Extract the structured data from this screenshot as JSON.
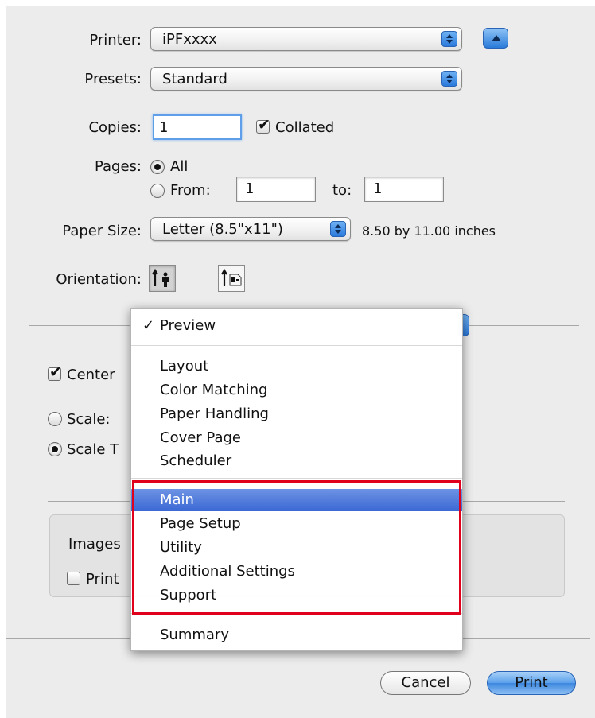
{
  "printer": {
    "label": "Printer:",
    "value": "iPFxxxx"
  },
  "presets": {
    "label": "Presets:",
    "value": "Standard"
  },
  "copies": {
    "label": "Copies:",
    "value": "1",
    "collated_label": "Collated",
    "collated_checked": true
  },
  "pages": {
    "label": "Pages:",
    "all_label": "All",
    "from_label": "From:",
    "from_value": "1",
    "to_label": "to:",
    "to_value": "1"
  },
  "paper_size": {
    "label": "Paper Size:",
    "value": "Letter (8.5\"x11\")",
    "dimensions": "8.50 by 11.00 inches"
  },
  "orientation": {
    "label": "Orientation:"
  },
  "behind": {
    "center_label": "Center",
    "scale_label": "Scale:",
    "scale_to_label": "Scale T",
    "images_label": "Images",
    "print_label": "Print"
  },
  "menu": {
    "checked_item": "Preview",
    "group1": [
      "Layout",
      "Color Matching",
      "Paper Handling",
      "Cover Page",
      "Scheduler"
    ],
    "group2": [
      "Main",
      "Page Setup",
      "Utility",
      "Additional Settings",
      "Support"
    ],
    "selected_item": "Main",
    "summary": "Summary"
  },
  "buttons": {
    "cancel": "Cancel",
    "print": "Print"
  },
  "colors": {
    "highlight_border": "#e0001b",
    "menu_selection": "#3b68d4",
    "accent": "#2a7ad9"
  }
}
